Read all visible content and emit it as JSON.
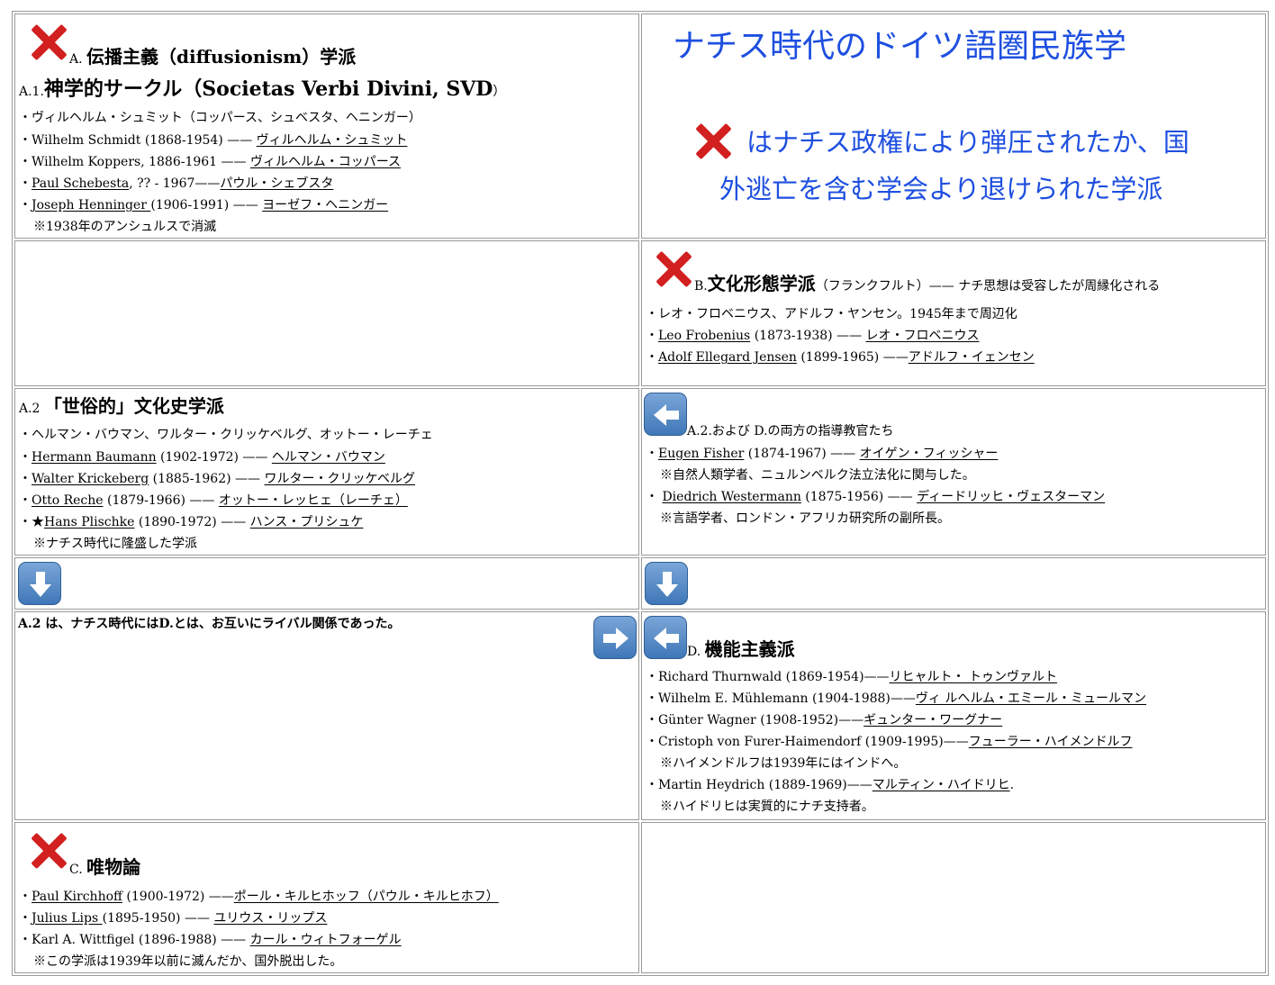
{
  "title": {
    "main": "ナチス時代のドイツ語圏民族学",
    "note_line1": "はナチス政権により弾圧されたか、国",
    "note_line2": "外逃亡を含む学会より退けられた学派"
  },
  "a": {
    "label": "A.",
    "heading": "伝播主義（diffusionism）学派",
    "a1_label": "A.1.",
    "a1_heading": "神学的サークル（Societas Verbi Divini, SVD",
    "a1_close": "）",
    "summary": "・ヴィルヘルム・シュミット（コッパース、シュベスタ、ヘニンガー）",
    "items": [
      {
        "prefix": "・",
        "name": "Wilhelm Schmidt (1868-1954) —— ",
        "jp": "ヴィルヘルム・シュミット"
      },
      {
        "prefix": "・",
        "name": "Wilhelm Koppers, 1886-1961 —— ",
        "jp": "ヴィルヘルム・コッパース"
      },
      {
        "prefix": "・",
        "name_link": "Paul Schebesta",
        "name": ", ?? - 1967——",
        "jp": "パウル・シェブスタ"
      },
      {
        "prefix": "・",
        "name_link": "Joseph Henninger ",
        "name": "(1906-1991) —— ",
        "jp": "ヨーゼフ・ヘニンガー"
      }
    ],
    "note": "※1938年のアンシュルスで消滅"
  },
  "b": {
    "label": "B.",
    "heading": "文化形態学派",
    "sub": "（フランクフルト）—— ナチ思想は受容したが周縁化される",
    "summary": "・レオ・フロベニウス、アドルフ・ヤンセン。1945年まで周辺化",
    "items": [
      {
        "prefix": "・",
        "name_link": "Leo Frobenius",
        "name": " (1873-1938) —— ",
        "jp": "レオ・フロベニウス"
      },
      {
        "prefix": "・",
        "name_link": "Adolf Ellegard Jensen",
        "name": " (1899-1965) ——",
        "jp": "アドルフ・イェンセン"
      }
    ]
  },
  "a2": {
    "label": "A.2",
    "heading": "「世俗的」文化史学派",
    "summary": "・ヘルマン・バウマン、ワルター・クリッケベルグ、オットー・レーチェ",
    "items": [
      {
        "prefix": "・",
        "name_link": "Hermann Baumann",
        "name": " (1902-1972) —— ",
        "jp": "ヘルマン・バウマン"
      },
      {
        "prefix": "・",
        "name_link": "Walter Krickeberg",
        "name": " (1885-1962) —— ",
        "jp": "ワルター・クリッケベルグ"
      },
      {
        "prefix": "・",
        "name_link": "Otto Reche",
        "name": " (1879-1966) —— ",
        "jp": "オットー・レッヒェ（レーチェ）"
      },
      {
        "prefix": "・★",
        "name_link": "Hans Plischke",
        "name": " (1890-1972) —— ",
        "jp": "ハンス・プリシュケ"
      }
    ],
    "note": "※ナチス時代に隆盛した学派"
  },
  "mentors": {
    "heading": "A.2.および D.の両方の指導教官たち",
    "items": [
      {
        "prefix": "・",
        "name_link": "Eugen Fisher",
        "name": " (1874-1967) —— ",
        "jp": "オイゲン・フィッシャー",
        "note": "※自然人類学者、ニュルンベルク法立法化に関与した。"
      },
      {
        "prefix": "・ ",
        "name_link": "Diedrich Westermann",
        "name": " (1875-1956) —— ",
        "jp": "ディードリッヒ・ヴェスターマン",
        "note": "※言語学者、ロンドン・アフリカ研究所の副所長。"
      }
    ]
  },
  "rivalry": {
    "text": "A.2 は、ナチス時代にはD.とは、お互いにライバル関係であった。"
  },
  "d": {
    "label": "D.",
    "heading": "機能主義派",
    "items": [
      {
        "prefix": "・",
        "name": "Richard Thurnwald (1869-1954)——",
        "jp": "リヒャルト・ トゥンヴァルト"
      },
      {
        "prefix": "・",
        "name": "Wilhelm E. Mühlemann (1904-1988)——",
        "jp": "ヴィ ルヘルム・エミール・ミュールマン"
      },
      {
        "prefix": "・",
        "name": "Günter Wagner (1908-1952)——",
        "jp": "ギュンター・ワーグナー"
      },
      {
        "prefix": "・",
        "name": "Cristoph von Furer-Haimendorf (1909-1995)——",
        "jp": "フューラー・ハイメンドルフ"
      },
      {
        "prefix": "・",
        "name": "Martin Heydrich (1889-1969)——",
        "jp": "マルティン・ハイドリヒ",
        "tail": "."
      }
    ],
    "note1": "※ハイメンドルフは1939年にはインドへ。",
    "note2": "※ハイドリヒは実質的にナチ支持者。"
  },
  "c": {
    "label": "C.",
    "heading": "唯物論",
    "items": [
      {
        "prefix": "・",
        "name_link": "Paul Kirchhoff",
        "name": " (1900-1972) ——",
        "jp": "ポール・キルヒホッフ（パウル・キルヒホフ）"
      },
      {
        "prefix": "・",
        "name_link": "Julius Lips ",
        "name": "(1895-1950) —— ",
        "jp": "ユリウス・リップス"
      },
      {
        "prefix": "・",
        "name": "Karl A. Wittfigel (1896-1988) —— ",
        "jp": "カール・ウィトフォーゲル"
      }
    ],
    "note": "※この学派は1939年以前に滅んだか、国外脱出した。"
  },
  "icons": {
    "x_mark": "x-mark-icon",
    "arrow_left": "arrow-left-icon",
    "arrow_right": "arrow-right-icon",
    "arrow_down": "arrow-down-icon"
  },
  "colors": {
    "x_red": "#d21f1f",
    "title_blue": "#1e4fe0",
    "arrow_blue": "#3f77b8"
  }
}
